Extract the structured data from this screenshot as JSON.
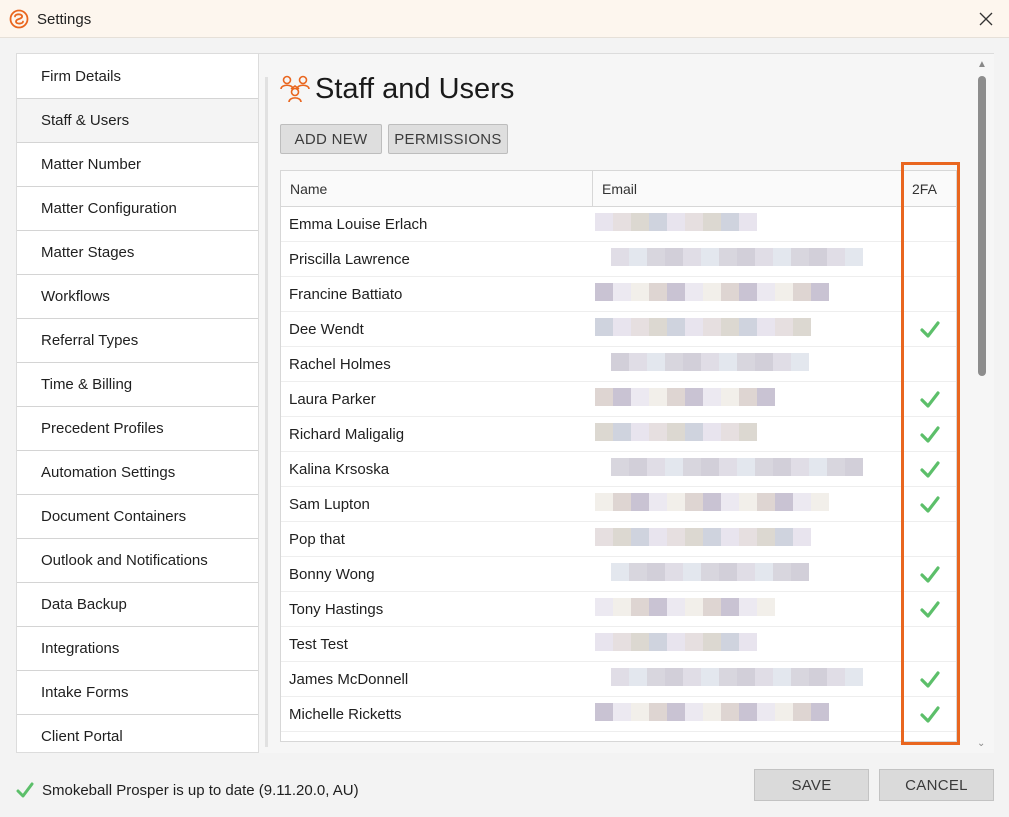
{
  "window": {
    "title": "Settings",
    "close_glyph": "✕",
    "logo_icon": "smokeball-logo-icon",
    "accent": "#e9661f"
  },
  "sidebar": {
    "items": [
      {
        "label": "Firm Details"
      },
      {
        "label": "Staff & Users",
        "active": true
      },
      {
        "label": "Matter Number"
      },
      {
        "label": "Matter Configuration"
      },
      {
        "label": "Matter Stages"
      },
      {
        "label": "Workflows"
      },
      {
        "label": "Referral Types"
      },
      {
        "label": "Time & Billing"
      },
      {
        "label": "Precedent Profiles"
      },
      {
        "label": "Automation Settings"
      },
      {
        "label": "Document Containers"
      },
      {
        "label": "Outlook and Notifications"
      },
      {
        "label": "Data Backup"
      },
      {
        "label": "Integrations"
      },
      {
        "label": "Intake Forms"
      },
      {
        "label": "Client Portal"
      }
    ]
  },
  "main": {
    "title": "Staff and Users",
    "title_icon": "staff-users-icon",
    "buttons": {
      "add_new": "ADD NEW",
      "permissions": "PERMISSIONS"
    },
    "table": {
      "columns": [
        "Name",
        "Email",
        "2FA"
      ],
      "rows": [
        {
          "name": "Emma Louise Erlach",
          "twofa": false
        },
        {
          "name": "Priscilla Lawrence",
          "twofa": false
        },
        {
          "name": "Francine Battiato",
          "twofa": false
        },
        {
          "name": "Dee Wendt",
          "twofa": true
        },
        {
          "name": "Rachel Holmes",
          "twofa": false
        },
        {
          "name": "Laura Parker",
          "twofa": true
        },
        {
          "name": "Richard Maligalig",
          "twofa": true
        },
        {
          "name": "Kalina Krsoska",
          "twofa": true
        },
        {
          "name": "Sam Lupton",
          "twofa": true
        },
        {
          "name": "Pop that",
          "twofa": false
        },
        {
          "name": "Bonny Wong",
          "twofa": true
        },
        {
          "name": "Tony Hastings",
          "twofa": true
        },
        {
          "name": "Test Test",
          "twofa": false
        },
        {
          "name": "James McDonnell",
          "twofa": true
        },
        {
          "name": "Michelle Ricketts",
          "twofa": true
        }
      ],
      "check_color": "#5cbf6a"
    }
  },
  "footer": {
    "status": "Smokeball Prosper is up to date (9.11.20.0, AU)",
    "save": "SAVE",
    "cancel": "CANCEL"
  }
}
